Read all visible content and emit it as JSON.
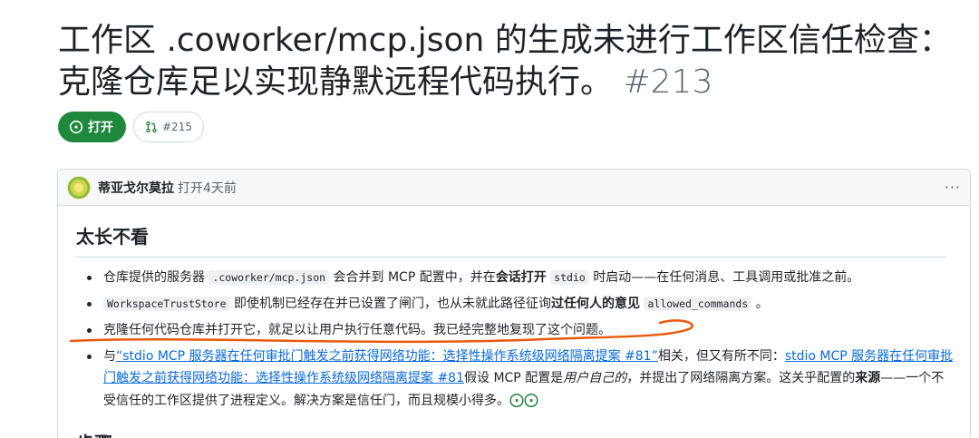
{
  "issue": {
    "title": "工作区 .coworker/mcp.json 的生成未进行工作区信任检查：克隆仓库足以实现静默远程代码执行。",
    "number": "#213",
    "state_label": "打开",
    "linked_pr": "#215"
  },
  "comment": {
    "author": "蒂亚戈尔莫拉",
    "opened_text": "打开4天前",
    "menu_label": "···",
    "heading": "太长不看",
    "bullets": {
      "b1": {
        "t1": "仓库提供的服务器 ",
        "code1": ".coworker/mcp.json",
        "t2": " 会合并到 MCP 配置中，并在",
        "bold1": "会话打开",
        "t3": " ",
        "code2": "stdio",
        "t4": " 时启动——在任何消息、工具调用或批准之前。"
      },
      "b2": {
        "code1": "WorkspaceTrustStore",
        "t1": " 即使机制已经存在并已设置了闸门，也从未就此路径征询",
        "bold1": "过任何人的意见",
        "t2": " ",
        "code2": "allowed_commands",
        "t3": " 。"
      },
      "b3": {
        "t1": "克隆任何代码仓库并打开它，就足以让用户执行任意代码。我已经完整地复现了这个问题。"
      },
      "b4": {
        "t1": "与",
        "link1": "“stdio MCP 服务器在任何审批门触发之前获得网络功能：选择性操作系统级网络隔离提案 #81”",
        "t2": "相关，但又有所不同：",
        "link2": "stdio MCP 服务器在任何审批门触发之前获得网络功能：选择性操作系统级网络隔离提案 #81",
        "t3": "假设 MCP 配置是",
        "em1": "用户自己的",
        "t4": "，并提出了网络隔离方案。这关乎配置的",
        "bold1": "来源",
        "t5": "——一个不受信任的工作区提供了进程定义。解决方案是信任门，而且规模小得多。",
        "emoji": "⨀⨀"
      }
    },
    "next_heading": "步骤"
  },
  "colors": {
    "open_green": "#1f883d",
    "link_blue": "#0969da",
    "annotation_orange": "#e8590c"
  }
}
